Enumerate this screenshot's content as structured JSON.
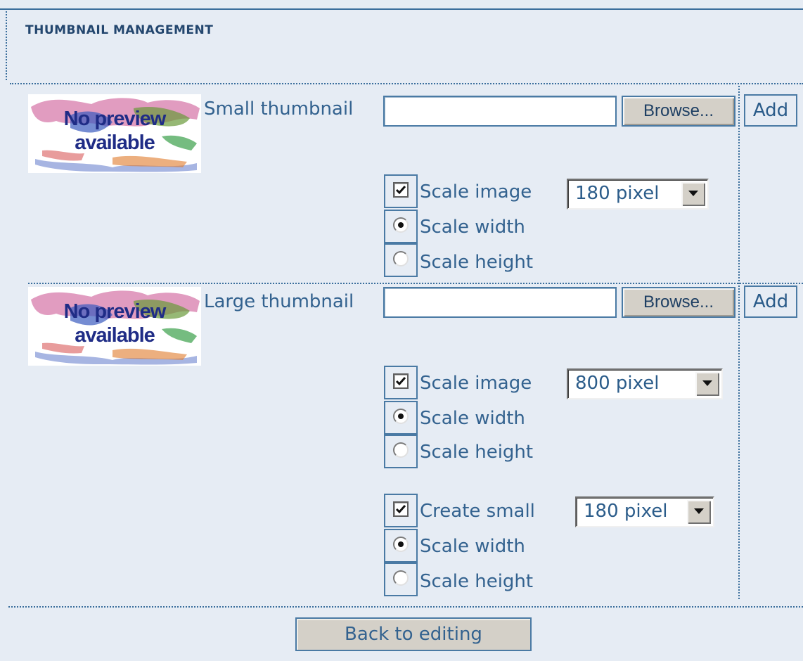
{
  "section": {
    "title": "THUMBNAIL MANAGEMENT"
  },
  "preview": {
    "text_line1": "No preview",
    "text_line2": "available"
  },
  "small": {
    "label": "Small thumbnail",
    "file_value": "",
    "browse_label": "Browse...",
    "add_label": "Add",
    "scale_image": {
      "label": "Scale image",
      "checked": true,
      "select_value": "180 pixel"
    },
    "scale_width": {
      "label": "Scale width",
      "selected": true
    },
    "scale_height": {
      "label": "Scale height",
      "selected": false
    }
  },
  "large": {
    "label": "Large thumbnail",
    "file_value": "",
    "browse_label": "Browse...",
    "add_label": "Add",
    "scale_image": {
      "label": "Scale image",
      "checked": true,
      "select_value": "800 pixel"
    },
    "scale_width": {
      "label": "Scale width",
      "selected": true
    },
    "scale_height": {
      "label": "Scale height",
      "selected": false
    },
    "create_small": {
      "label": "Create small",
      "checked": true,
      "select_value": "180 pixel"
    },
    "create_small_scale_width": {
      "label": "Scale width",
      "selected": true
    },
    "create_small_scale_height": {
      "label": "Scale height",
      "selected": false
    }
  },
  "footer": {
    "back_label": "Back to editing"
  },
  "colors": {
    "background": "#e6ecf4",
    "text": "#2b5c8a",
    "border": "#4a7aa4",
    "button_face": "#d4d0c8"
  }
}
